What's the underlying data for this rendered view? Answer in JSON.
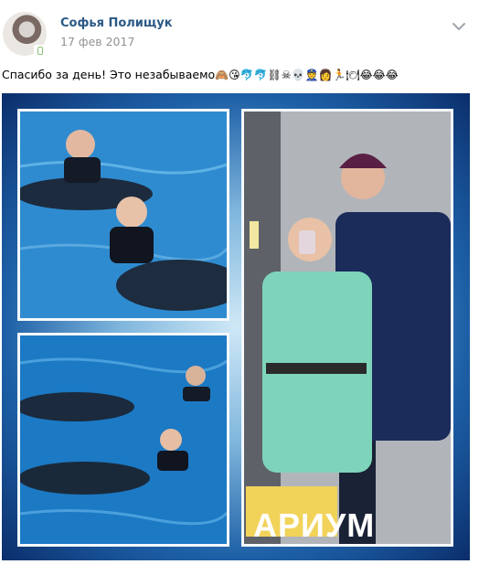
{
  "post": {
    "author": "Софья Полищук",
    "date": "17 фев 2017",
    "text": "Спасибо за день! Это незабываемо",
    "emojis": [
      "🙈",
      "😘",
      "🐬",
      "🐬",
      "⛓",
      "☠",
      "💀",
      "👮",
      "👩",
      "🏃",
      "🍽",
      "😂",
      "😂",
      "😂"
    ]
  },
  "photo": {
    "tiles": [
      {
        "name": "photo-dolphin-pool-1"
      },
      {
        "name": "photo-dolphin-pool-2"
      },
      {
        "name": "photo-elevator-selfie"
      }
    ],
    "bag_text": "АРИУМ"
  },
  "icons": {
    "online": "mobile-online-icon",
    "menu": "chevron-down-icon"
  },
  "colors": {
    "link": "#2a5885",
    "date": "#939393",
    "frame": "#1d5fa6"
  }
}
